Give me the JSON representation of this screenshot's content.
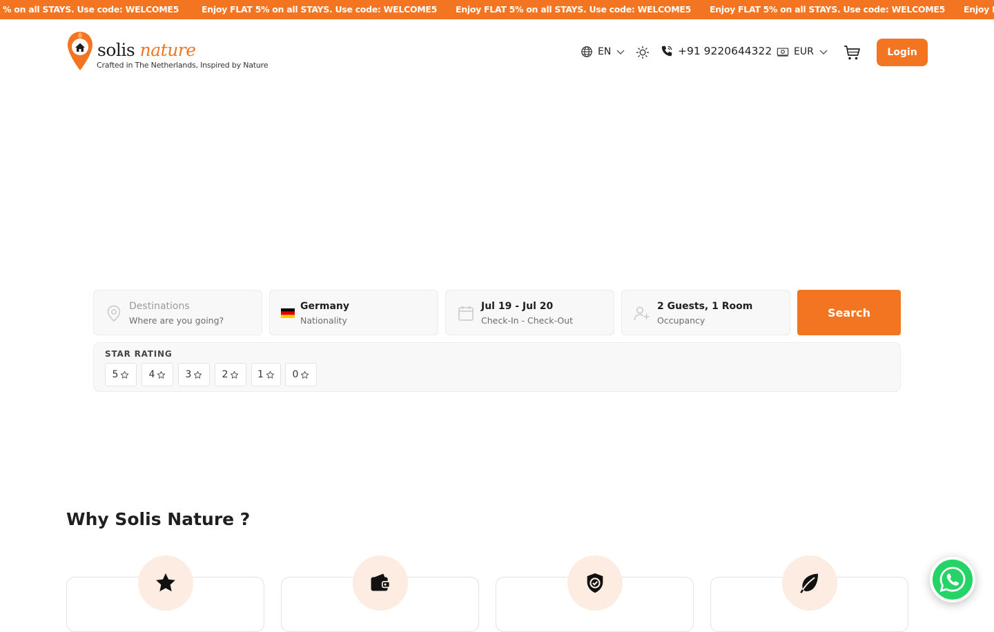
{
  "promo": {
    "items": [
      "% on all STAYS. Use code: WELCOME5",
      "Enjoy FLAT 5% on all STAYS. Use code: WELCOME5",
      "Enjoy FLAT 5% on all STAYS. Use code: WELCOME5",
      "Enjoy FLAT 5% on all STAYS. Use code: WELCOME5",
      "Enjoy I"
    ]
  },
  "brand": {
    "name_part1": "solis",
    "name_part2": "nature",
    "tagline": "Crafted in The Netherlands, Inspired by Nature",
    "accent": "#f47521"
  },
  "header": {
    "language": "EN",
    "phone": "+91 9220644322",
    "currency": "EUR",
    "login_label": "Login"
  },
  "search": {
    "destination": {
      "title": "Destinations",
      "subtitle": "Where are you going?"
    },
    "nationality": {
      "title": "Germany",
      "subtitle": "Nationality"
    },
    "dates": {
      "title": "Jul 19 - Jul 20",
      "subtitle": "Check-In - Check-Out"
    },
    "occupancy": {
      "title": "2 Guests, 1 Room",
      "subtitle": "Occupancy"
    },
    "button_label": "Search"
  },
  "star_rating": {
    "label": "STAR RATING",
    "options": [
      "5",
      "4",
      "3",
      "2",
      "1",
      "0"
    ]
  },
  "why": {
    "title": "Why Solis Nature ?",
    "cards": [
      {
        "icon": "star-icon"
      },
      {
        "icon": "wallet-icon"
      },
      {
        "icon": "shield-check-icon"
      },
      {
        "icon": "leaf-icon"
      }
    ]
  }
}
